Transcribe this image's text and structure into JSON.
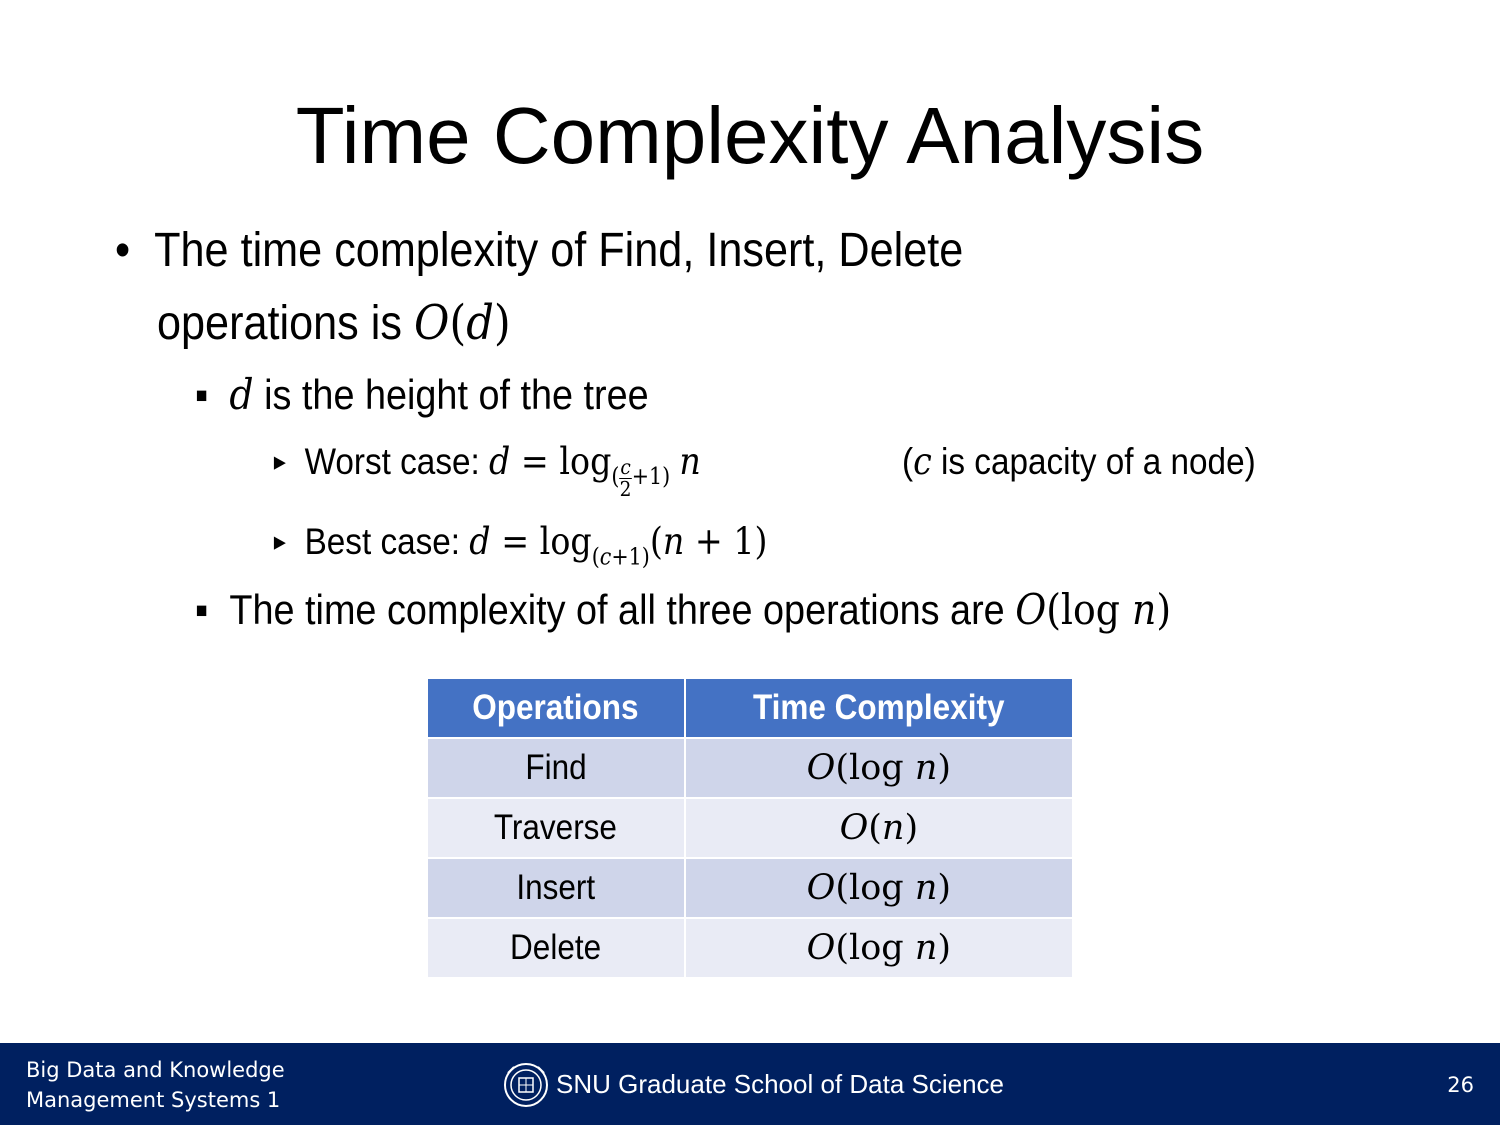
{
  "title": "Time Complexity Analysis",
  "bullet1": {
    "line1": "The time complexity of Find, Insert, Delete",
    "line2_prefix": "operations is ",
    "O": "O",
    "d": "d"
  },
  "sub1": {
    "d": "d",
    "text": " is the height of the tree"
  },
  "worst": {
    "label": "Worst case: ",
    "d": "d",
    "eq": " = log",
    "frac_num": "c",
    "frac_den": "2",
    "base_rest": "+1)",
    "n": "n",
    "note_open": "(",
    "note_c": "c",
    "note_text": " is capacity of a node)"
  },
  "best": {
    "label": "Best case: ",
    "d": "d",
    "eq": " = log",
    "base_open": "(",
    "c": "c",
    "base_rest": "+1)",
    "arg_open": "(",
    "n": "n",
    "arg_rest": " + 1)"
  },
  "sub2": {
    "text": "The time complexity of all three operations are ",
    "O": "O",
    "log": "(log ",
    "n": "n",
    "close": ")"
  },
  "table": {
    "headers": [
      "Operations",
      "Time Complexity"
    ],
    "rows": [
      {
        "op": "Find",
        "O": "O",
        "arg": "(log ",
        "n": "n",
        "close": ")"
      },
      {
        "op": "Traverse",
        "O": "O",
        "arg": "(",
        "n": "n",
        "close": ")"
      },
      {
        "op": "Insert",
        "O": "O",
        "arg": "(log ",
        "n": "n",
        "close": ")"
      },
      {
        "op": "Delete",
        "O": "O",
        "arg": "(log ",
        "n": "n",
        "close": ")"
      }
    ]
  },
  "footer": {
    "course_line1": "Big Data and Knowledge",
    "course_line2": "Management Systems 1",
    "school": "SNU Graduate School of Data Science",
    "page": "26",
    "logo_icon": "snu-emblem-icon"
  },
  "colors": {
    "header_bg": "#4472c4",
    "row_odd": "#cfd5ea",
    "row_even": "#e9ebf5",
    "footer_bg": "#002060"
  }
}
